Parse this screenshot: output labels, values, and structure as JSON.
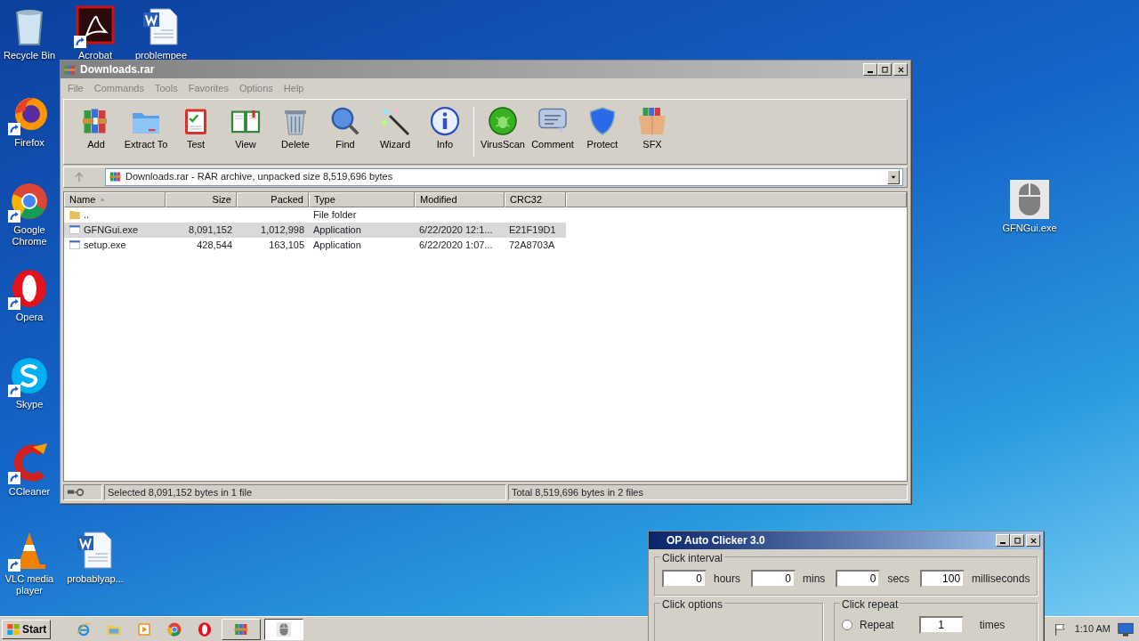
{
  "desktop_icons": [
    {
      "label": "Recycle Bin",
      "kind": "recycle",
      "shortcut": false
    },
    {
      "label": "Acrobat",
      "kind": "acrobat",
      "shortcut": true
    },
    {
      "label": "problempee",
      "kind": "word",
      "shortcut": false
    },
    {
      "label": "Firefox",
      "kind": "firefox",
      "shortcut": true
    },
    {
      "label": "Google Chrome",
      "kind": "chrome",
      "shortcut": true
    },
    {
      "label": "Opera",
      "kind": "opera",
      "shortcut": true
    },
    {
      "label": "Skype",
      "kind": "skype",
      "shortcut": true
    },
    {
      "label": "CCleaner",
      "kind": "ccleaner",
      "shortcut": true
    },
    {
      "label": "VLC media player",
      "kind": "vlc",
      "shortcut": true
    },
    {
      "label": "probablyap...",
      "kind": "word",
      "shortcut": false
    },
    {
      "label": "GFNGui.exe",
      "kind": "mouse",
      "shortcut": false
    }
  ],
  "archive_window": {
    "title": "Downloads.rar",
    "active": false,
    "menu": [
      "File",
      "Commands",
      "Tools",
      "Favorites",
      "Options",
      "Help"
    ],
    "toolbar": [
      {
        "label": "Add",
        "kind": "add"
      },
      {
        "label": "Extract To",
        "kind": "extract"
      },
      {
        "label": "Test",
        "kind": "test"
      },
      {
        "label": "View",
        "kind": "view"
      },
      {
        "label": "Delete",
        "kind": "delete"
      },
      {
        "label": "Find",
        "kind": "find"
      },
      {
        "label": "Wizard",
        "kind": "wizard"
      },
      {
        "label": "Info",
        "kind": "info"
      },
      {
        "label": "VirusScan",
        "kind": "virus"
      },
      {
        "label": "Comment",
        "kind": "comment"
      },
      {
        "label": "Protect",
        "kind": "protect"
      },
      {
        "label": "SFX",
        "kind": "sfx"
      }
    ],
    "path": "Downloads.rar - RAR archive, unpacked size 8,519,696 bytes",
    "columns": [
      {
        "label": "Name",
        "sorted": true
      },
      {
        "label": "Size",
        "sorted": false
      },
      {
        "label": "Packed",
        "sorted": false
      },
      {
        "label": "Type",
        "sorted": false
      },
      {
        "label": "Modified",
        "sorted": false
      },
      {
        "label": "CRC32",
        "sorted": false
      }
    ],
    "rows": [
      {
        "kind": "folder",
        "selected": false,
        "cells": [
          "..",
          "",
          "",
          "File folder",
          "",
          ""
        ]
      },
      {
        "kind": "exe",
        "selected": true,
        "cells": [
          "GFNGui.exe",
          "8,091,152",
          "1,012,998",
          "Application",
          "6/22/2020 12:1...",
          "E21F19D1"
        ]
      },
      {
        "kind": "exe",
        "selected": false,
        "cells": [
          "setup.exe",
          "428,544",
          "163,105",
          "Application",
          "6/22/2020 1:07...",
          "72A8703A"
        ]
      }
    ],
    "status_left": "Selected 8,091,152 bytes in 1 file",
    "status_right": "Total 8,519,696 bytes in 2 files"
  },
  "clicker_window": {
    "title": "OP Auto Clicker 3.0",
    "active": true,
    "interval_label": "Click interval",
    "interval_fields": [
      {
        "value": "0",
        "unit": "hours"
      },
      {
        "value": "0",
        "unit": "mins"
      },
      {
        "value": "0",
        "unit": "secs"
      },
      {
        "value": "100",
        "unit": "milliseconds"
      }
    ],
    "options_label": "Click options",
    "repeat_label": "Click repeat",
    "repeat_option": "Repeat",
    "repeat_checked": false,
    "repeat_value": "1",
    "repeat_unit": "times"
  },
  "taskbar": {
    "start": "Start",
    "buttons": [
      {
        "kind": "ie"
      },
      {
        "kind": "explorer"
      },
      {
        "kind": "media"
      },
      {
        "kind": "chrome"
      },
      {
        "kind": "opera"
      },
      {
        "kind": "winrar",
        "selected": false
      },
      {
        "kind": "mouse",
        "selected": true
      }
    ],
    "clock": "1:10 AM"
  }
}
